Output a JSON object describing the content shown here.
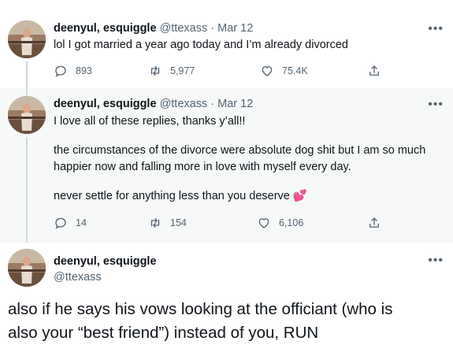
{
  "tweets": [
    {
      "name": "deenyul, esquiggle",
      "handle": "@ttexass",
      "sep": "·",
      "date": "Mar 12",
      "text": [
        "lol I got married a year ago today and I’m already divorced"
      ],
      "stats": {
        "replies": "893",
        "retweets": "5,977",
        "likes": "75.4K"
      }
    },
    {
      "name": "deenyul, esquiggle",
      "handle": "@ttexass",
      "sep": "·",
      "date": "Mar 12",
      "text": [
        "I love all of these replies, thanks y’all!!",
        "the circumstances of the divorce were absolute dog shit but I am so much",
        "happier now and falling more in love with myself every day.",
        "never settle for anything less than you deserve"
      ],
      "emoji": "💕",
      "stats": {
        "replies": "14",
        "retweets": "154",
        "likes": "6,106"
      }
    },
    {
      "name": "deenyul, esquiggle",
      "handle": "@ttexass",
      "text": [
        "also if he says his vows looking at the officiant (who is",
        "also your “best friend”) instead of you, RUN"
      ]
    }
  ],
  "icons": {
    "reply": "reply-icon",
    "retweet": "retweet-icon",
    "like": "heart-icon",
    "share": "share-icon",
    "more": "more-icon"
  },
  "colors": {
    "secondary_text": "#536471",
    "thread_line": "#cfd9de",
    "highlight_bg": "#f7f9f9",
    "heart_emoji": "#e0245e"
  }
}
